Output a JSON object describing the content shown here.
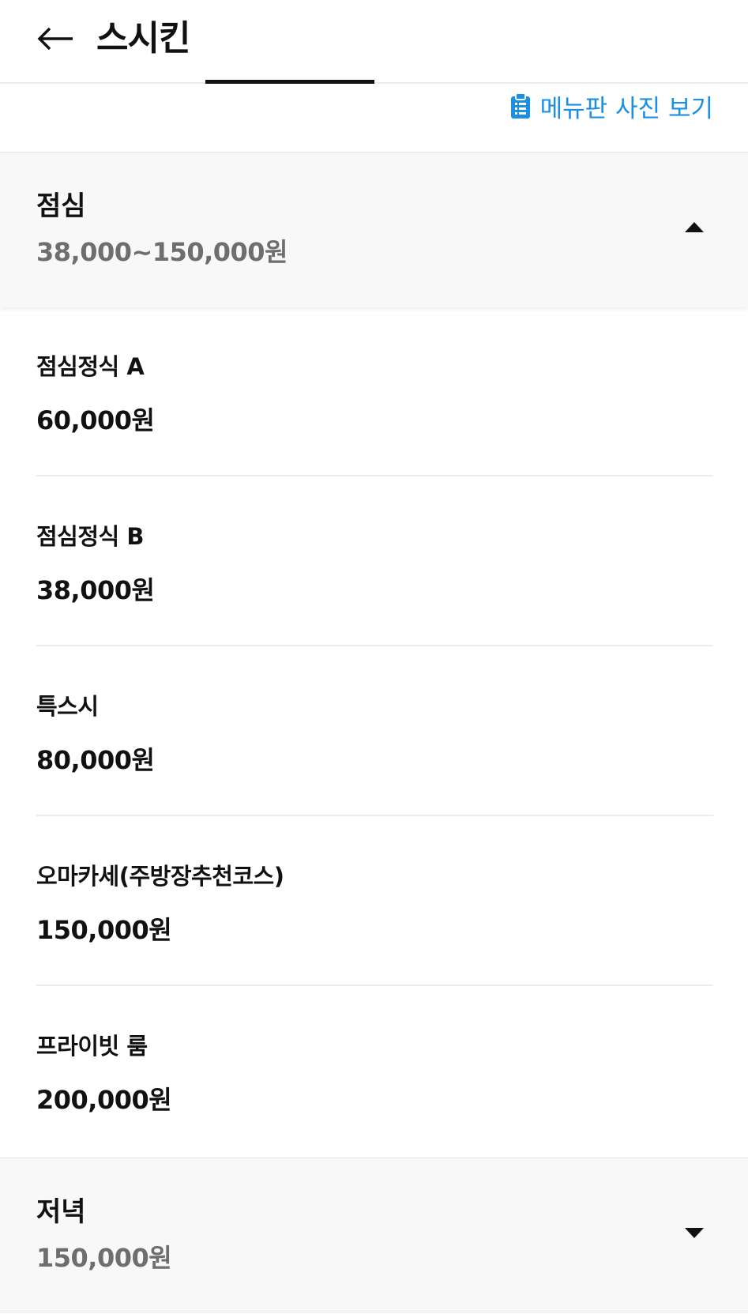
{
  "header": {
    "title": "스시킨",
    "back_icon": "arrow-left-icon"
  },
  "menu_photo": {
    "icon": "clipboard-icon",
    "label": "메뉴판 사진 보기",
    "color": "#1a8fe3"
  },
  "sections": [
    {
      "name": "점심",
      "price_range": "38,000~150,000원",
      "expanded": true,
      "items": [
        {
          "name": "점심정식 A",
          "price": "60,000원"
        },
        {
          "name": "점심정식 B",
          "price": "38,000원"
        },
        {
          "name": "특스시",
          "price": "80,000원"
        },
        {
          "name": "오마카세(주방장추천코스)",
          "price": "150,000원"
        },
        {
          "name": "프라이빗 룸",
          "price": "200,000원"
        }
      ]
    },
    {
      "name": "저녁",
      "price_range": "150,000원",
      "expanded": false
    }
  ]
}
